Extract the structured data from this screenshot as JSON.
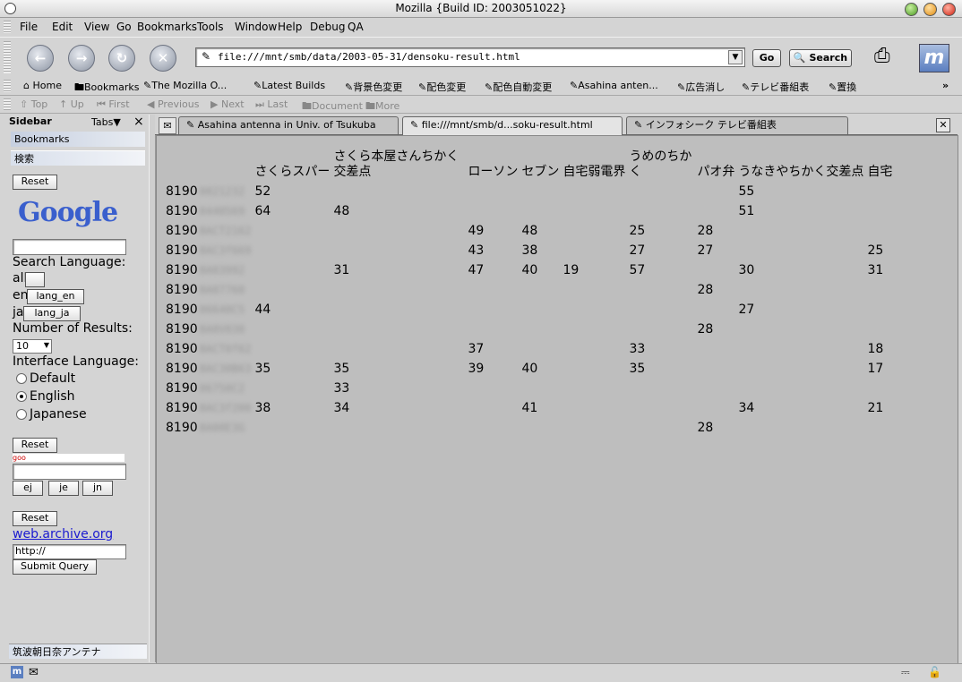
{
  "window": {
    "title": "Mozilla {Build ID: 2003051022}"
  },
  "menu": [
    "File",
    "Edit",
    "View",
    "Go",
    "Bookmarks",
    "Tools",
    "Window",
    "Help",
    "Debug",
    "QA"
  ],
  "nav": {
    "url": "file:///mnt/smb/data/2003-05-31/densoku-result.html",
    "go_label": "Go",
    "search_label": "Search"
  },
  "personal_bar": [
    "Home",
    "Bookmarks",
    "The Mozilla O...",
    "Latest Builds",
    "背景色変更",
    "配色変更",
    "配色自動変更",
    "Asahina anten...",
    "広告消し",
    "テレビ番組表",
    "置換"
  ],
  "personal_more": "»",
  "site_nav": [
    "Top",
    "Up",
    "First",
    "Previous",
    "Next",
    "Last",
    "Document",
    "More"
  ],
  "sidebar": {
    "title": "Sidebar",
    "tabs_label": "Tabs",
    "close": "×",
    "panels": [
      "Bookmarks",
      "検索"
    ],
    "reset": "Reset",
    "google_logo": "Google",
    "search_language": "Search Language:",
    "all": "all",
    "en": "en",
    "ja": "ja",
    "lang_en": "lang_en",
    "lang_ja": "lang_ja",
    "number_results": "Number of Results:",
    "num_value": "10",
    "interface_language": "Interface Language:",
    "radio_default": "Default",
    "radio_english": "English",
    "radio_japanese": "Japanese",
    "goo_logo": "goo",
    "ej": "ej",
    "je": "je",
    "jn": "jn",
    "archive_link": "web.archive.org",
    "http_value": "http://",
    "submit": "Submit Query",
    "bottom_panel": "筑波朝日奈アンテナ"
  },
  "tabs": [
    "Asahina antenna in Univ. of Tsukuba",
    "file:///mnt/smb/d...soku-result.html",
    "インフォシーク テレビ番組表"
  ],
  "table": {
    "headers": [
      "",
      "さくらスパー",
      "さくら本屋さんちかく交差点",
      "ローソン",
      "セブン",
      "自宅弱電界",
      "うめのちかく",
      "パオ弁",
      "うなきやちかく交差点",
      "自宅"
    ],
    "rows": [
      {
        "id": "8190",
        "masked": "0821232",
        "cells": [
          "52",
          "",
          "",
          "",
          "",
          "",
          "",
          "55",
          ""
        ]
      },
      {
        "id": "8190",
        "masked": "0440569",
        "cells": [
          "64",
          "48",
          "",
          "",
          "",
          "",
          "",
          "51",
          ""
        ]
      },
      {
        "id": "8190",
        "masked": "8ACT2162",
        "cells": [
          "",
          "",
          "49",
          "48",
          "",
          "25",
          "28",
          "",
          ""
        ]
      },
      {
        "id": "8190",
        "masked": "8AC3f669",
        "cells": [
          "",
          "",
          "43",
          "38",
          "",
          "27",
          "27",
          "",
          "25"
        ]
      },
      {
        "id": "8190",
        "masked": "8A03992",
        "cells": [
          "",
          "31",
          "47",
          "40",
          "19",
          "57",
          "",
          "30",
          "31"
        ]
      },
      {
        "id": "8190",
        "masked": "8A07760",
        "cells": [
          "",
          "",
          "",
          "",
          "",
          "",
          "28",
          "",
          ""
        ]
      },
      {
        "id": "8190",
        "masked": "06640C5",
        "cells": [
          "44",
          "",
          "",
          "",
          "",
          "",
          "",
          "27",
          ""
        ]
      },
      {
        "id": "8190",
        "masked": "8A0V030",
        "cells": [
          "",
          "",
          "",
          "",
          "",
          "",
          "28",
          "",
          ""
        ]
      },
      {
        "id": "8190",
        "masked": "8ACT0f62",
        "cells": [
          "",
          "",
          "37",
          "",
          "",
          "33",
          "",
          "",
          "18"
        ]
      },
      {
        "id": "8190",
        "masked": "8AC30B63",
        "cells": [
          "35",
          "35",
          "39",
          "40",
          "",
          "35",
          "",
          "",
          "17"
        ]
      },
      {
        "id": "8190",
        "masked": "06750C2",
        "cells": [
          "",
          "33",
          "",
          "",
          "",
          "",
          "",
          "",
          ""
        ]
      },
      {
        "id": "8190",
        "masked": "8AC3f200",
        "cells": [
          "38",
          "34",
          "",
          "41",
          "",
          "",
          "",
          "34",
          "21"
        ]
      },
      {
        "id": "8190",
        "masked": "8A08E3G",
        "cells": [
          "",
          "",
          "",
          "",
          "",
          "",
          "28",
          "",
          ""
        ]
      }
    ]
  }
}
